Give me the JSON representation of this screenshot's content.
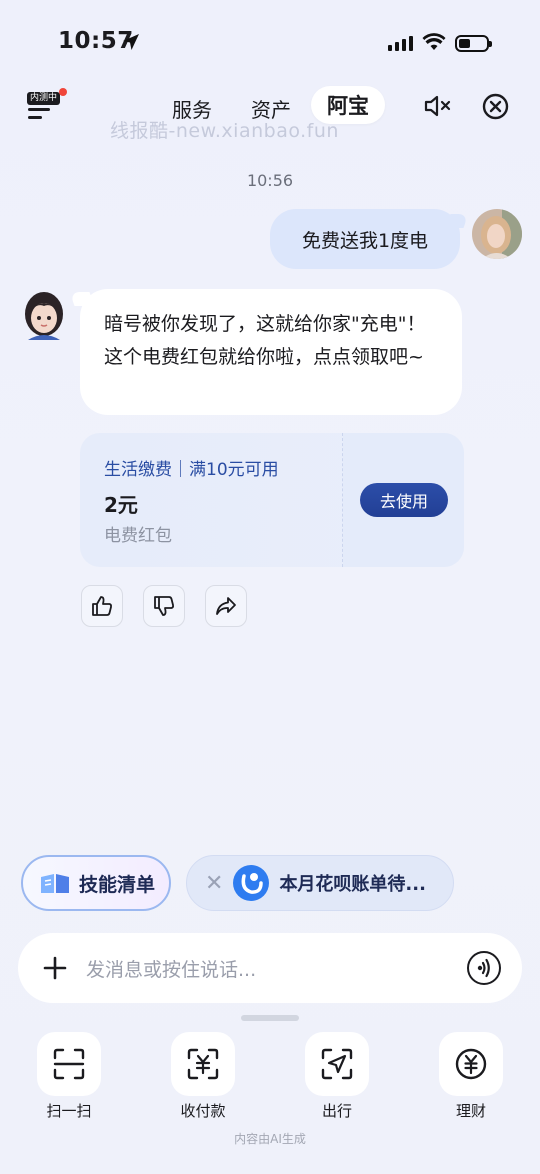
{
  "status_bar": {
    "time": "10:57"
  },
  "header": {
    "badge": "内测中",
    "tabs": [
      "服务",
      "资产",
      "阿宝"
    ],
    "active_tab": "阿宝",
    "watermark": "线报酷-new.xianbao.fun"
  },
  "chat": {
    "timestamp": "10:56",
    "user_message": "免费送我1度电",
    "bot_message": "暗号被你发现了，这就给你家\"充电\"！这个电费红包就给你啦，点点领取吧~",
    "coupon": {
      "condition": "生活缴费｜满10元可用",
      "amount": "2元",
      "name": "电费红包",
      "button": "去使用"
    }
  },
  "chips": {
    "skills": "技能清单",
    "notice": "本月花呗账单待..."
  },
  "input": {
    "placeholder": "发消息或按住说话..."
  },
  "tools": [
    {
      "label": "扫一扫",
      "icon": "scan-icon"
    },
    {
      "label": "收付款",
      "icon": "payment-icon"
    },
    {
      "label": "出行",
      "icon": "travel-icon"
    },
    {
      "label": "理财",
      "icon": "finance-icon"
    }
  ],
  "footer": "内容由AI生成",
  "colors": {
    "accent": "#223f95",
    "bubble_user": "#dce6fb",
    "coupon_text": "#2a4da3"
  }
}
